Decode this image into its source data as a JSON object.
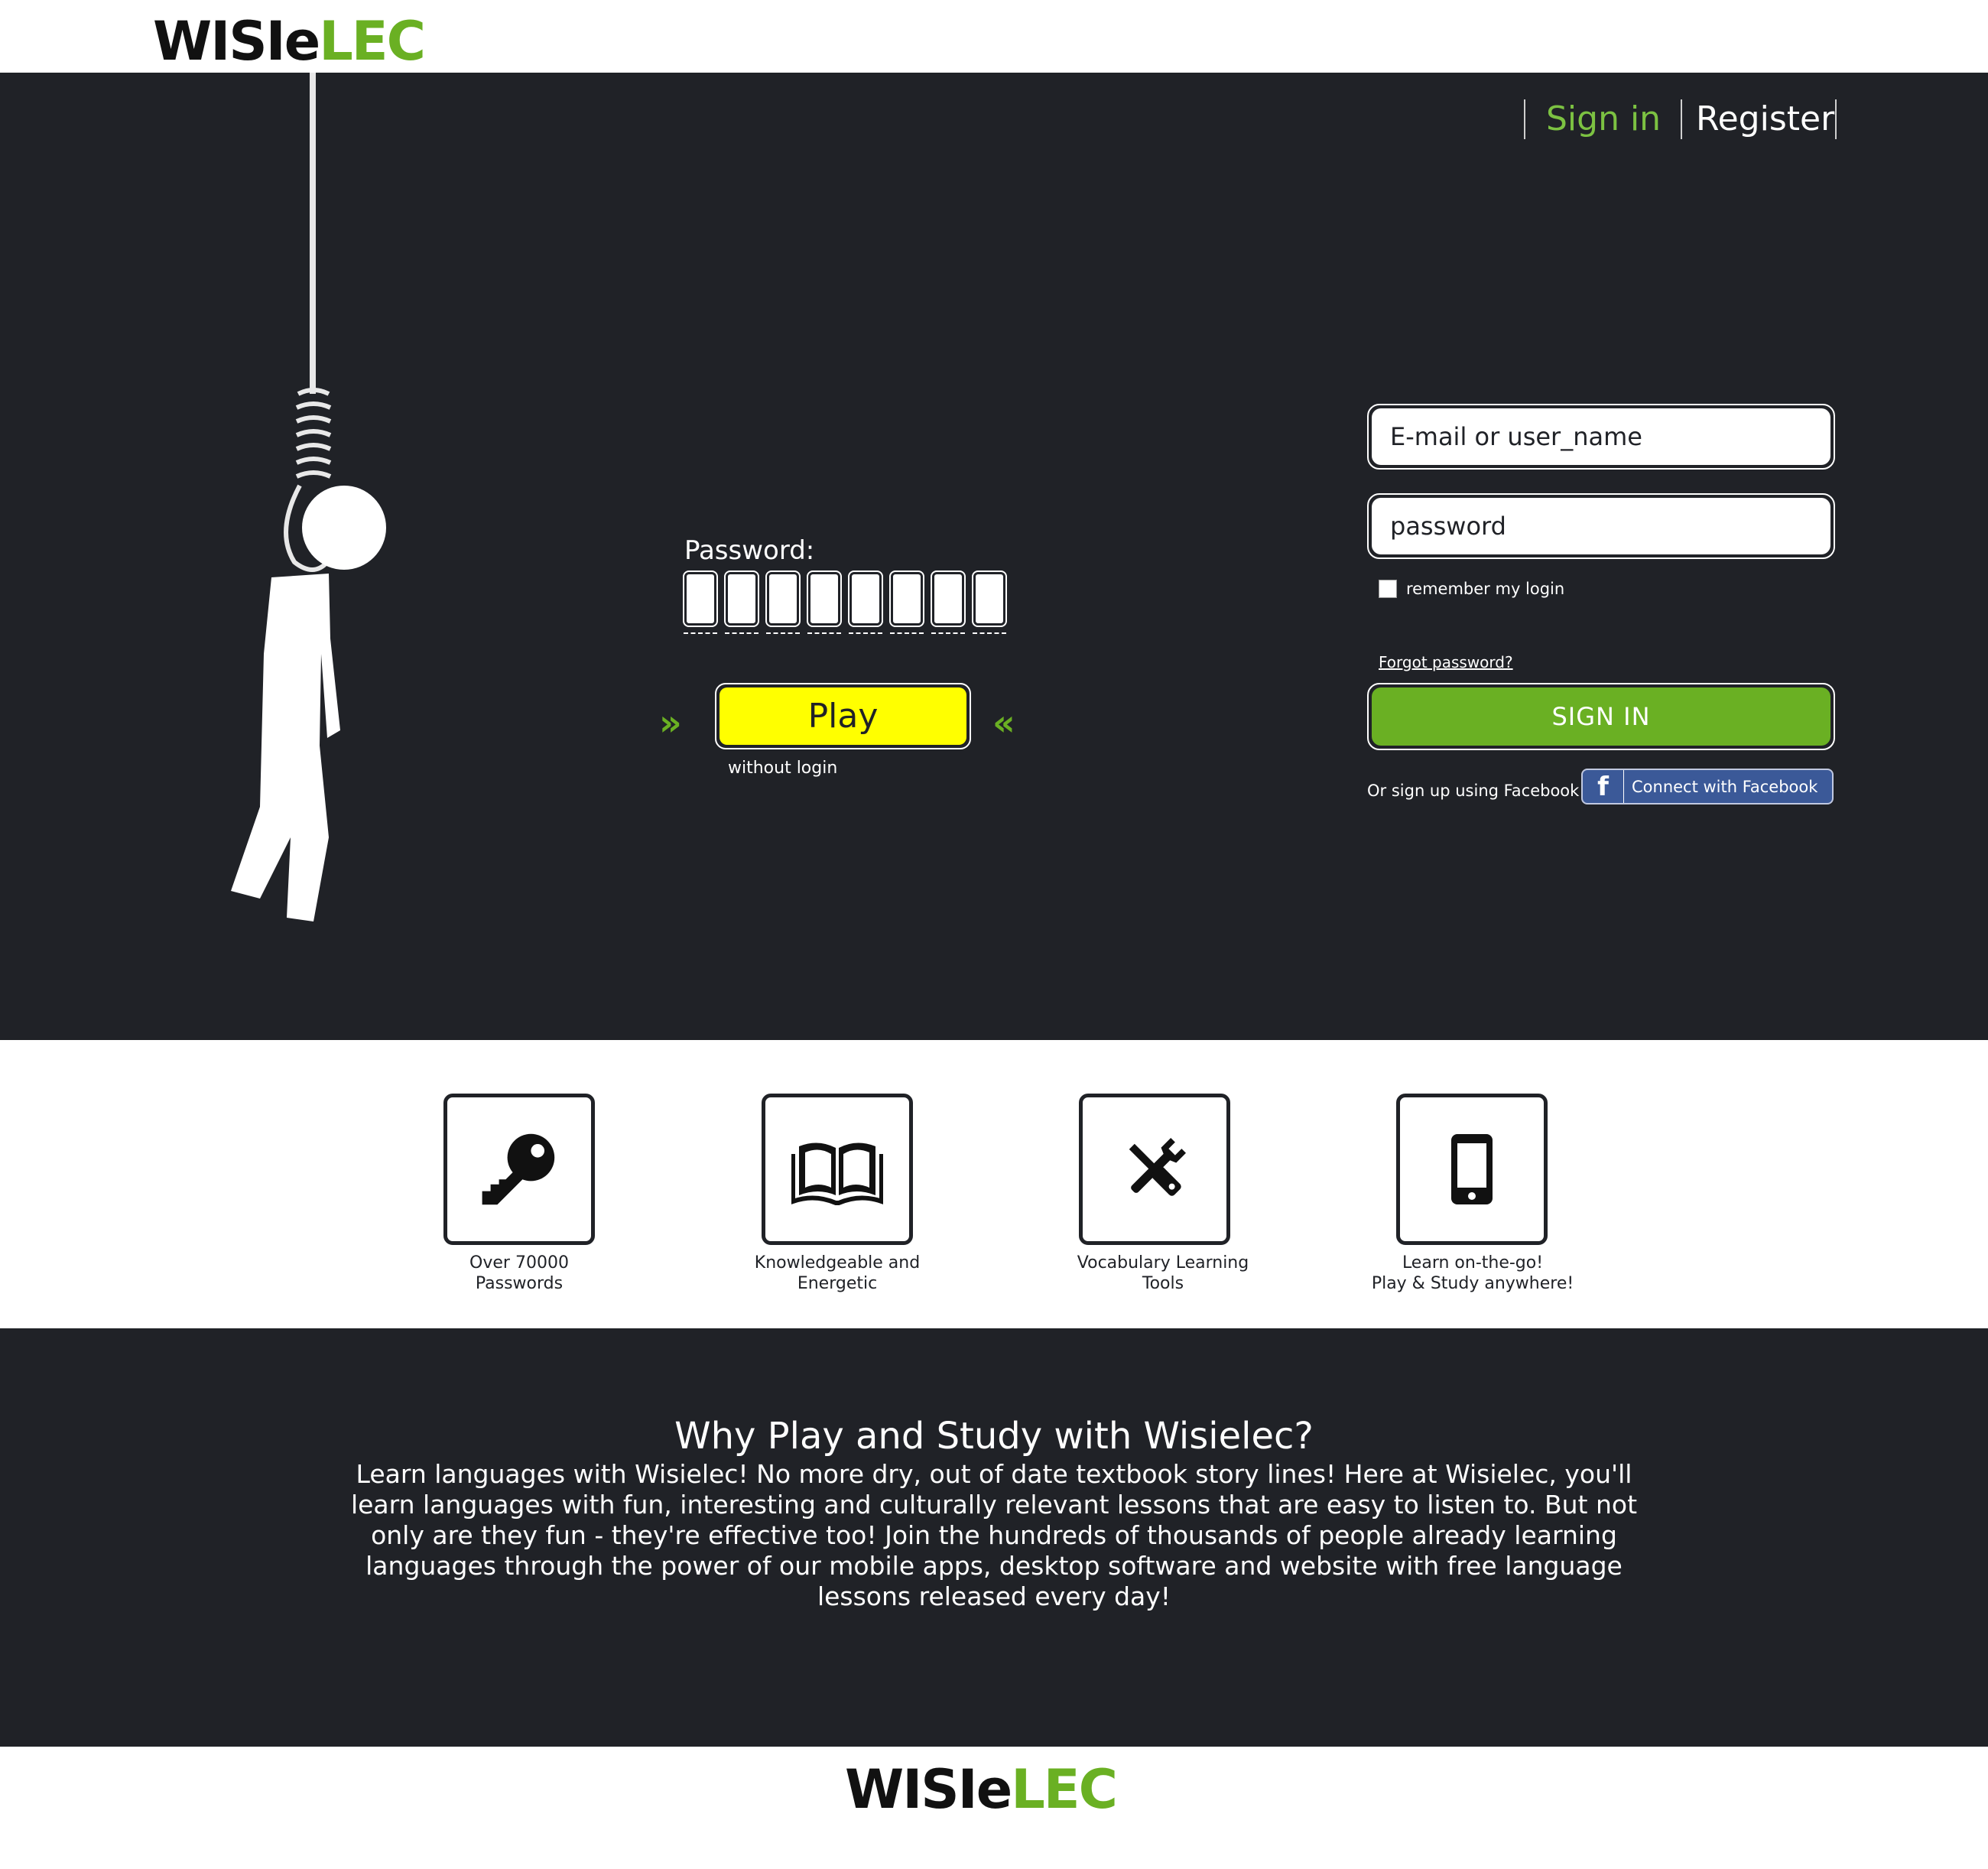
{
  "header": {
    "logo_dark": "WISI",
    "logo_mark": "e",
    "logo_green": "LEC"
  },
  "nav": {
    "signin": "Sign in",
    "register": "Register"
  },
  "game": {
    "password_label": "Password:",
    "password_slots": 8,
    "arrows_left": "»",
    "arrows_right": "«",
    "play_label": "Play",
    "without_login": "without login"
  },
  "login": {
    "email_placeholder": "E-mail or user_name",
    "password_placeholder": "password",
    "remember_label": "remember my login",
    "forgot_label": "Forgot password?",
    "signin_label": "SIGN IN",
    "facebook_prompt": "Or sign up using Facebook",
    "facebook_icon": "f",
    "facebook_button": "Connect with Facebook"
  },
  "features": [
    {
      "icon": "key-icon",
      "line1": "Over 70000",
      "line2": "Passwords"
    },
    {
      "icon": "book-icon",
      "line1": "Knowledgeable and",
      "line2": "Energetic"
    },
    {
      "icon": "tools-icon",
      "line1": "Vocabulary Learning",
      "line2": "Tools"
    },
    {
      "icon": "phone-icon",
      "line1": "Learn on-the-go!",
      "line2": "Play & Study anywhere!"
    }
  ],
  "why": {
    "title": "Why Play and Study with Wisielec?",
    "body": "Learn languages with Wisielec! No more dry, out of date textbook story lines! Here at Wisielec, you'll learn languages with fun, interesting and culturally relevant lessons that are easy to listen to. But not only are they fun - they're effective too! Join the hundreds of thousands of people already learning languages through the power of our mobile apps, desktop software and website with free language lessons released every day!"
  },
  "colors": {
    "dark_bg": "#202227",
    "accent_green": "#6ab023",
    "nav_green": "#7cc242",
    "play_yellow": "#ffff00",
    "facebook_blue": "#3b5998"
  }
}
